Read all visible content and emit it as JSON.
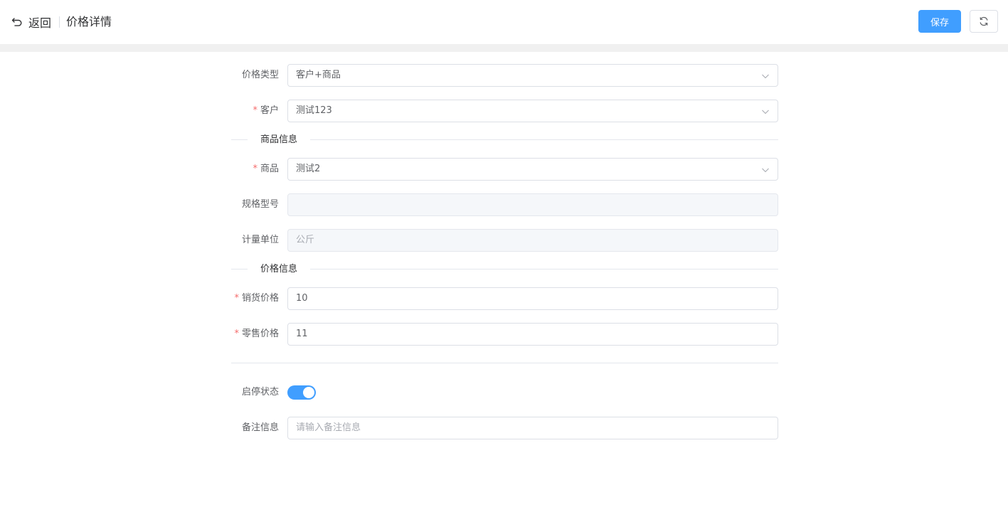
{
  "header": {
    "back_label": "返回",
    "title": "价格详情",
    "save_label": "保存"
  },
  "form": {
    "price_type": {
      "label": "价格类型",
      "value": "客户+商品"
    },
    "customer": {
      "label": "客户",
      "value": "测试123",
      "required_mark": "*"
    },
    "section_product": "商品信息",
    "product": {
      "label": "商品",
      "value": "测试2",
      "required_mark": "*"
    },
    "spec": {
      "label": "规格型号",
      "value": ""
    },
    "unit": {
      "label": "计量单位",
      "value": "公斤"
    },
    "section_price": "价格信息",
    "sale_price": {
      "label": "销货价格",
      "value": "10",
      "required_mark": "*"
    },
    "retail_price": {
      "label": "零售价格",
      "value": "11",
      "required_mark": "*"
    },
    "status": {
      "label": "启停状态",
      "enabled": true
    },
    "remark": {
      "label": "备注信息",
      "placeholder": "请输入备注信息"
    }
  },
  "colors": {
    "primary": "#409eff",
    "required": "#f56c6c",
    "disabled_bg": "#f5f7fa"
  },
  "icons": {
    "back": "undo-arrow-icon",
    "refresh": "refresh-icon",
    "select": "chevron-down-icon"
  }
}
